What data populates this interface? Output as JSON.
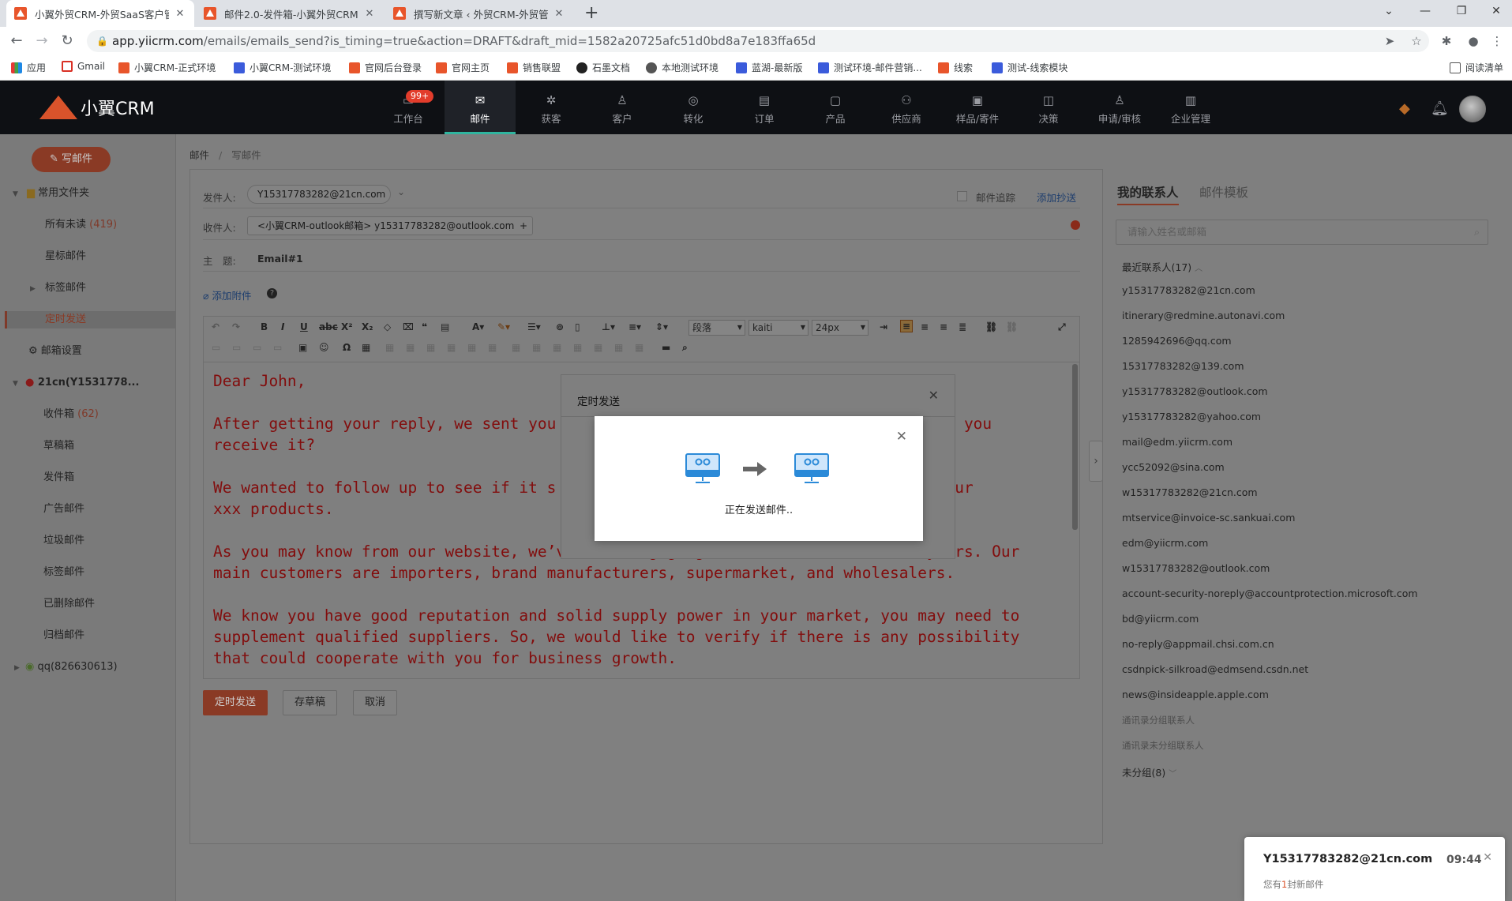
{
  "browser": {
    "tabs": [
      {
        "title": "小翼外贸CRM-外贸SaaS客户管理",
        "active": true
      },
      {
        "title": "邮件2.0-发件箱-小翼外贸CRM",
        "active": false
      },
      {
        "title": "撰写新文章 ‹ 外贸CRM-外贸管理",
        "active": false
      }
    ],
    "url_host": "app.yiicrm.com",
    "url_path": "/emails/emails_send?is_timing=true&action=DRAFT&draft_mid=1582a20725afc51d0bd8a7e183ffa65d",
    "bookmarks": [
      "应用",
      "Gmail",
      "小翼CRM-正式环境",
      "小翼CRM-测试环境",
      "官网后台登录",
      "官网主页",
      "销售联盟",
      "石墨文档",
      "本地测试环境",
      "蓝湖-最新版",
      "测试环境-邮件营销...",
      "线索",
      "测试-线索模块"
    ],
    "reading_list": "阅读清单"
  },
  "app": {
    "logo_text": "小翼CRM",
    "badge": "99+",
    "nav": [
      "工作台",
      "邮件",
      "获客",
      "客户",
      "转化",
      "订单",
      "产品",
      "供应商",
      "样品/寄件",
      "决策",
      "申请/审核",
      "企业管理"
    ],
    "active_nav": "邮件"
  },
  "sidebar": {
    "compose_label": "写邮件",
    "common_folder": "常用文件夹",
    "all_unread": "所有未读",
    "all_unread_count": "(419)",
    "starred": "星标邮件",
    "tag_mail": "标签邮件",
    "scheduled": "定时发送",
    "mail_settings": "邮箱设置",
    "account1": "21cn(Y1531778...",
    "inbox": "收件箱",
    "inbox_count": "(62)",
    "drafts": "草稿箱",
    "sent": "发件箱",
    "ads": "广告邮件",
    "spam": "垃圾邮件",
    "tag_mail2": "标签邮件",
    "deleted": "已删除邮件",
    "archived": "归档邮件",
    "account2": "qq(826630613)"
  },
  "compose": {
    "breadcrumb_root": "邮件",
    "breadcrumb_sep": "/",
    "breadcrumb_current": "写邮件",
    "from_label": "发件人:",
    "from_value": "Y15317783282@21cn.com",
    "track_label": "邮件追踪",
    "add_cc": "添加抄送",
    "to_label": "收件人:",
    "to_value": "<小翼CRM-outlook邮箱> y15317783282@outlook.com",
    "subject_label": "主　题:",
    "subject_value": "Email#1",
    "attach_label": "添加附件",
    "toolbar": {
      "para": "段落",
      "font": "kaiti",
      "size": "24px"
    },
    "body": "Dear John,\n\nAfter getting your reply, we sent you                                      , did you\nreceive it?\n\nWe wanted to follow up to see if it s                                    st of our\nxxx products.\n\nAs you may know from our website, we’ve been engaging in the xxx field for 5 years. Our\nmain customers are importers, brand manufacturers, supermarket, and wholesalers.\n\nWe know you have good reputation and solid supply power in your market, you may need to\nsupplement qualified suppliers. So, we would like to verify if there is any possibility\nthat could cooperate with you for business growth.",
    "btn_schedule": "定时发送",
    "btn_draft": "存草稿",
    "btn_cancel": "取消"
  },
  "right_panel": {
    "tab_contacts": "我的联系人",
    "tab_templates": "邮件模板",
    "search_placeholder": "请输入姓名或邮箱",
    "recent_header": "最近联系人(17)",
    "contacts": [
      "y15317783282@21cn.com",
      "itinerary@redmine.autonavi.com",
      "1285942696@qq.com",
      "15317783282@139.com",
      "y15317783282@outlook.com",
      "y15317783282@yahoo.com",
      "mail@edm.yiicrm.com",
      "ycc52092@sina.com",
      "w15317783282@21cn.com",
      "mtservice@invoice-sc.sankuai.com",
      "edm@yiicrm.com",
      "w15317783282@outlook.com",
      "account-security-noreply@accountprotection.microsoft.com",
      "bd@yiicrm.com",
      "no-reply@appmail.chsi.com.cn",
      "csdnpick-silkroad@edmsend.csdn.net",
      "news@insideapple.apple.com"
    ],
    "group_grouped": "通讯录分组联系人",
    "group_ungrouped": "通讯录未分组联系人",
    "unassigned": "未分组(8)"
  },
  "dialog": {
    "outer_title": "定时发送",
    "message": "正在发送邮件.."
  },
  "toast": {
    "from": "Y15317783282@21cn.com",
    "time": "09:44",
    "msg_prefix": "您有",
    "msg_count": "1",
    "msg_suffix": "封新邮件"
  },
  "colors": {
    "brand": "#d9532b",
    "header_bg": "#0e1014",
    "accent_active": "#2fb59f"
  }
}
